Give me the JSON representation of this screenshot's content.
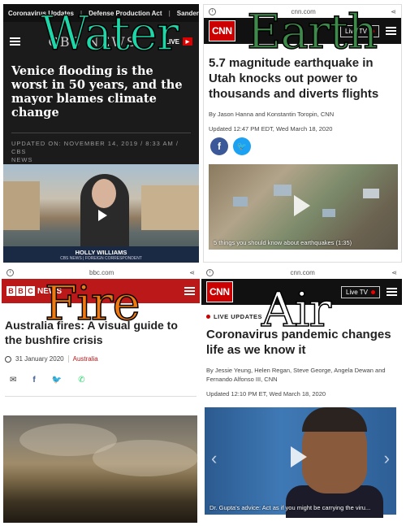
{
  "cbs": {
    "nav": [
      "Coronavirus Updates",
      "Defense Production Act",
      "Sanders To"
    ],
    "logo": "CBS NEWS",
    "live": "LIVE",
    "headline": "Venice flooding is the worst in 50 years, and the mayor blames climate change",
    "meta_line1": "UPDATED ON: NOVEMBER 14, 2019 / 8:33 AM / CBS",
    "meta_line2": "NEWS",
    "lower_name": "HOLLY WILLIAMS",
    "lower_title": "CBS NEWS | FOREIGN CORRESPONDENT",
    "overlay": "Water"
  },
  "cnn_quake": {
    "url": "cnn.com",
    "logo": "CNN",
    "live_tv": "Live TV",
    "headline": "5.7 magnitude earthquake in Utah knocks out power to thousands and diverts flights",
    "byline": "By Jason Hanna and Konstantin Toropin, CNN",
    "updated": "Updated 12:47 PM EDT, Wed March 18, 2020",
    "video_caption": "5 things you should know about earthquakes (1:35)",
    "overlay": "Earth"
  },
  "bbc": {
    "url": "bbc.com",
    "logo_letters": [
      "B",
      "B",
      "C"
    ],
    "news": "NEWS",
    "headline": "Australia fires: A visual guide to the bushfire crisis",
    "date": "31 January 2020",
    "topic": "Australia",
    "overlay": "Fire"
  },
  "cnn_covid": {
    "url": "cnn.com",
    "logo": "CNN",
    "live_tv": "Live TV",
    "live_update": "LIVE UPDATES",
    "headline": "Coronavirus pandemic changes life as we know it",
    "byline": "By Jessie Yeung, Helen Regan, Steve George, Angela Dewan and Fernando Alfonso III, CNN",
    "updated": "Updated 12:10 PM ET, Wed March 18, 2020",
    "video_caption": "Dr. Gupta's advice: Act as if you might be carrying the viru...",
    "overlay": "Air"
  },
  "colors": {
    "cnn_red": "#cc0000",
    "bbc_red": "#bb1919",
    "water": "#1fd6a8",
    "earth": "#3d8a4a",
    "fire": "#f07a10",
    "air": "#ffffff"
  }
}
